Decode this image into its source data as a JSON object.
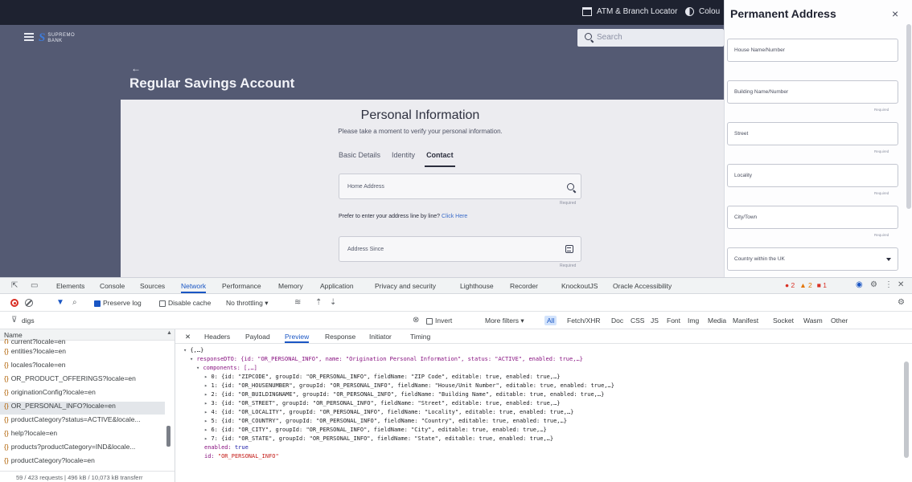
{
  "app": {
    "topbar": {
      "atm_locator": "ATM & Branch Locator",
      "colour": "Colou"
    },
    "navbar": {
      "logo_mark": "S",
      "logo_text": "SUPREMO",
      "logo_sub": "BANK",
      "search_placeholder": "Search"
    },
    "hero": {
      "title": "Regular Savings Account"
    },
    "form": {
      "title": "Personal Information",
      "subtitle": "Please take a moment to verify your personal information.",
      "tabs": [
        "Basic Details",
        "Identity",
        "Contact"
      ],
      "home_address_label": "Home Address",
      "required": "Required",
      "prefer_text": "Prefer to enter your address line by line?",
      "click_here": "Click Here",
      "address_since_label": "Address Since"
    }
  },
  "panel": {
    "title": "Permanent Address",
    "close": "×",
    "fields": [
      {
        "label": "House Name/Number",
        "required": ""
      },
      {
        "label": "Building Name/Number",
        "required": "Required"
      },
      {
        "label": "Street",
        "required": "Required"
      },
      {
        "label": "Locality",
        "required": "Required"
      },
      {
        "label": "City/Town",
        "required": "Required"
      },
      {
        "label": "Country within the UK",
        "required": ""
      }
    ]
  },
  "devtools": {
    "tabs": [
      "Elements",
      "Console",
      "Sources",
      "Network",
      "Performance",
      "Memory",
      "Application",
      "Privacy and security",
      "Lighthouse",
      "Recorder",
      "KnockoutJS",
      "Oracle Accessibility"
    ],
    "badges": {
      "errors": "2",
      "warnings": "2",
      "issues": "1"
    },
    "toolbar": {
      "preserve_log": "Preserve log",
      "disable_cache": "Disable cache",
      "throttling": "No throttling"
    },
    "filter": {
      "text": "digs",
      "invert": "Invert",
      "more_filters": "More filters",
      "types": [
        "All",
        "Fetch/XHR",
        "Doc",
        "CSS",
        "JS",
        "Font",
        "Img",
        "Media",
        "Manifest",
        "Socket",
        "Wasm",
        "Other"
      ]
    },
    "requests": {
      "header": "Name",
      "items": [
        "current?locale=en",
        "entities?locale=en",
        "locales?locale=en",
        "OR_PRODUCT_OFFERINGS?locale=en",
        "originationConfig?locale=en",
        "OR_PERSONAL_INFO?locale=en",
        "productCategory?status=ACTIVE&locale...",
        "help?locale=en",
        "products?productCategory=IND&locale...",
        "productCategory?locale=en"
      ],
      "status": "59 / 423 requests  |  496 kB / 10,073 kB transferr"
    },
    "detail_tabs": [
      "Headers",
      "Payload",
      "Preview",
      "Response",
      "Initiator",
      "Timing"
    ],
    "preview": {
      "root": "{,…}",
      "responseDTO": "responseDTO: {id: \"OR_PERSONAL_INFO\", name: \"Origination Personal Information\", status: \"ACTIVE\", enabled: true,…}",
      "components": "components: [,…]",
      "rows": [
        "0: {id: \"ZIPCODE\", groupId: \"OR_PERSONAL_INFO\", fieldName: \"ZIP Code\", editable: true, enabled: true,…}",
        "1: {id: \"OR_HOUSENUMBER\", groupId: \"OR_PERSONAL_INFO\", fieldName: \"House/Unit Number\", editable: true, enabled: true,…}",
        "2: {id: \"OR_BUILDINGNAME\", groupId: \"OR_PERSONAL_INFO\", fieldName: \"Building Name\", editable: true, enabled: true,…}",
        "3: {id: \"OR_STREET\", groupId: \"OR_PERSONAL_INFO\", fieldName: \"Street\", editable: true, enabled: true,…}",
        "4: {id: \"OR_LOCALITY\", groupId: \"OR_PERSONAL_INFO\", fieldName: \"Locality\", editable: true, enabled: true,…}",
        "5: {id: \"OR_COUNTRY\", groupId: \"OR_PERSONAL_INFO\", fieldName: \"Country\", editable: true, enabled: true,…}",
        "6: {id: \"OR_CITY\", groupId: \"OR_PERSONAL_INFO\", fieldName: \"City\", editable: true, enabled: true,…}",
        "7: {id: \"OR_STATE\", groupId: \"OR_PERSONAL_INFO\", fieldName: \"State\", editable: true, enabled: true,…}"
      ],
      "enabled_key": "enabled:",
      "enabled_val": "true",
      "id_key": "id:",
      "id_val": "\"OR_PERSONAL_INFO\""
    }
  }
}
